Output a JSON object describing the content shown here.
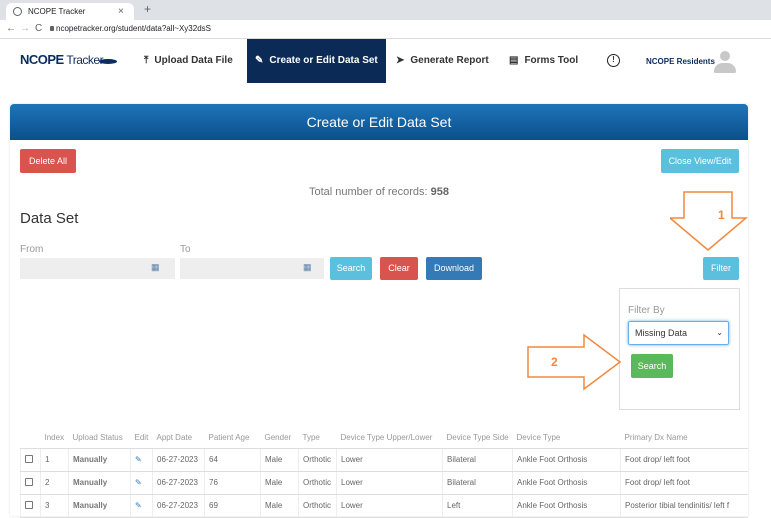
{
  "browser": {
    "tab_title": "NCOPE Tracker",
    "tab_close": "×",
    "new_tab": "+",
    "url": "ncopetracker.org/student/data?all~Xy32dsS",
    "back": "←",
    "forward": "→",
    "reload": "C"
  },
  "nav": {
    "logo": "NCOPE",
    "logo_suffix": " Tracker",
    "upload": "Upload Data File",
    "create": "Create or Edit Data Set",
    "report": "Generate Report",
    "forms": "Forms Tool",
    "alert": "!",
    "user": "NCOPE Residents"
  },
  "panel": {
    "title": "Create or Edit Data Set",
    "delete_all": "Delete All",
    "close_view": "Close View/Edit",
    "total_prefix": "Total number of records: ",
    "total_count": "958",
    "dataset_heading": "Data Set",
    "from_label": "From",
    "to_label": "To",
    "search": "Search",
    "clear": "Clear",
    "download": "Download",
    "filter": "Filter"
  },
  "filter_box": {
    "label": "Filter By",
    "selected": "Missing Data",
    "search": "Search"
  },
  "annotations": {
    "one": "1",
    "two": "2",
    "color": "#f0883e"
  },
  "table": {
    "headers": [
      "",
      "Index",
      "Upload Status",
      "Edit",
      "Appt Date",
      "Patient Age",
      "Gender",
      "Type",
      "Device Type Upper/Lower",
      "Device Type Side",
      "Device Type",
      "Primary Dx Name"
    ],
    "rows": [
      [
        "1",
        "Manually",
        "06-27-2023",
        "64",
        "Male",
        "Orthotic",
        "Lower",
        "Bilateral",
        "Ankle Foot Orthosis",
        "Foot drop/ left foot"
      ],
      [
        "2",
        "Manually",
        "06-27-2023",
        "76",
        "Male",
        "Orthotic",
        "Lower",
        "Bilateral",
        "Ankle Foot Orthosis",
        "Foot drop/ left foot"
      ],
      [
        "3",
        "Manually",
        "06-27-2023",
        "69",
        "Male",
        "Orthotic",
        "Lower",
        "Left",
        "Ankle Foot Orthosis",
        "Posterior tibial tendinitis/ left f"
      ]
    ]
  },
  "colors": {
    "nav_active": "#0b2a55",
    "banner": "#1e75ba",
    "danger": "#d9534f",
    "info": "#5bc0de",
    "primary": "#337ab7",
    "success": "#5cb85c"
  }
}
